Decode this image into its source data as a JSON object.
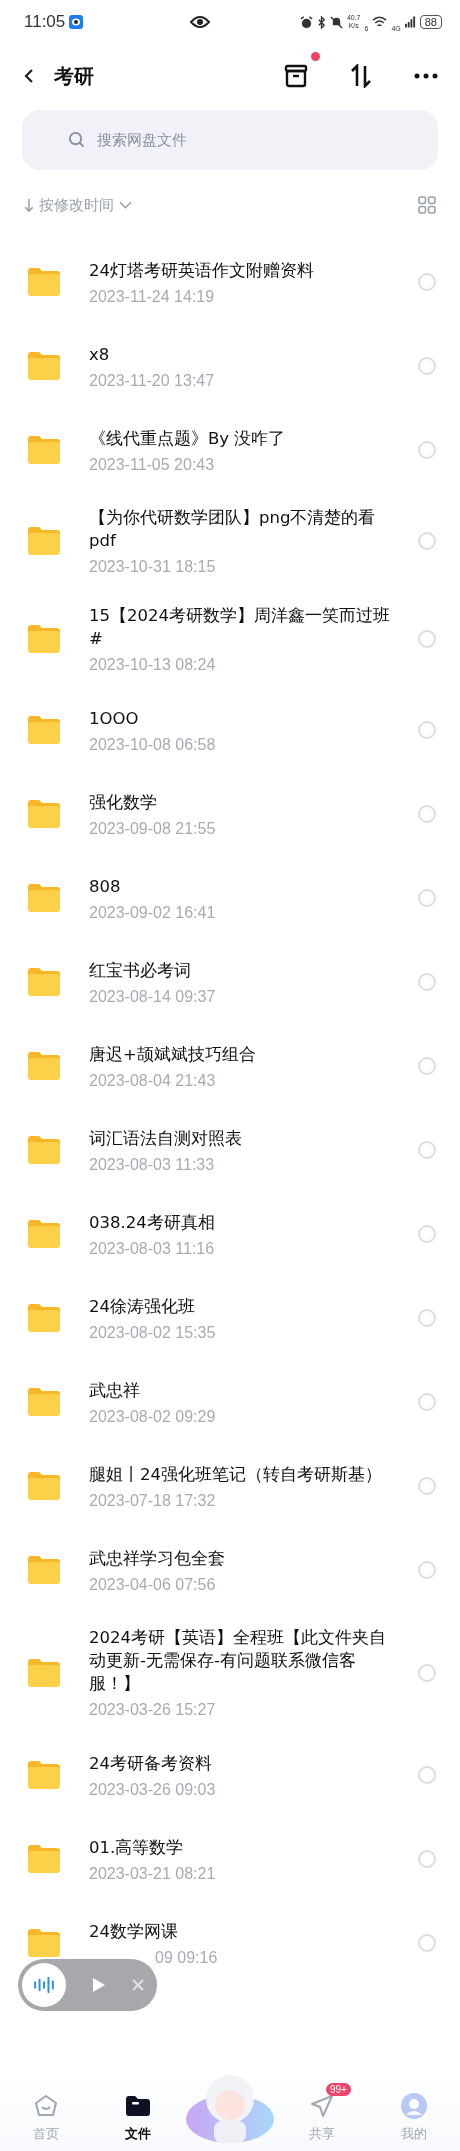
{
  "status_bar": {
    "time": "11:05",
    "speed": "40.7",
    "speed_unit": "K/s",
    "wifi_mark": "6",
    "network": "4G",
    "battery": "88"
  },
  "nav": {
    "title": "考研",
    "notification_dot": true
  },
  "search": {
    "placeholder": "搜索网盘文件"
  },
  "sort": {
    "label": "按修改时间"
  },
  "files": [
    {
      "name": "24灯塔考研英语作文附赠资料",
      "date": "2023-11-24  14:19",
      "selected": false
    },
    {
      "name": "x8",
      "date": "2023-11-20  13:47",
      "selected": false
    },
    {
      "name": "《线代重点题》By 没咋了",
      "date": "2023-11-05  20:43",
      "selected": false
    },
    {
      "name": "【为你代研数学团队】png不清楚的看pdf",
      "date": "2023-10-31  18:15",
      "selected": false
    },
    {
      "name": "15【2024考研数学】周洋鑫一笑而过班#",
      "date": "2023-10-13  08:24",
      "selected": false
    },
    {
      "name": "1OOO",
      "date": "2023-10-08  06:58",
      "selected": false
    },
    {
      "name": "强化数学",
      "date": "2023-09-08  21:55",
      "selected": false
    },
    {
      "name": "808",
      "date": "2023-09-02  16:41",
      "selected": false
    },
    {
      "name": "红宝书必考词",
      "date": "2023-08-14  09:37",
      "selected": false
    },
    {
      "name": "唐迟+颉斌斌技巧组合",
      "date": "2023-08-04  21:43",
      "selected": false
    },
    {
      "name": "词汇语法自测对照表",
      "date": "2023-08-03  11:33",
      "selected": false
    },
    {
      "name": "038.24考研真相",
      "date": "2023-08-03  11:16",
      "selected": false
    },
    {
      "name": "24徐涛强化班",
      "date": "2023-08-02  15:35",
      "selected": false
    },
    {
      "name": "武忠祥",
      "date": "2023-08-02  09:29",
      "selected": false
    },
    {
      "name": "腿姐丨24强化班笔记（转自考研斯基）",
      "date": "2023-07-18  17:32",
      "selected": false
    },
    {
      "name": "武忠祥学习包全套",
      "date": "2023-04-06  07:56",
      "selected": false
    },
    {
      "name": "2024考研【英语】全程班【此文件夹自动更新-无需保存-有问题联系微信客服！】",
      "date": "2023-03-26  15:27",
      "selected": false
    },
    {
      "name": "24考研备考资料",
      "date": "2023-03-26  09:03",
      "selected": false
    },
    {
      "name": "01.高等数学",
      "date": "2023-03-21  08:21",
      "selected": false
    },
    {
      "name": "24数学网课",
      "date": "09  09:16",
      "selected": false
    }
  ],
  "tabs": [
    {
      "kind": "home",
      "label": "首页",
      "selected": false
    },
    {
      "kind": "files",
      "label": "文件",
      "selected": true
    },
    {
      "kind": "mascot"
    },
    {
      "kind": "share",
      "label": "共享",
      "selected": false,
      "badge": "99+"
    },
    {
      "kind": "me",
      "label": "我的",
      "selected": false
    }
  ]
}
